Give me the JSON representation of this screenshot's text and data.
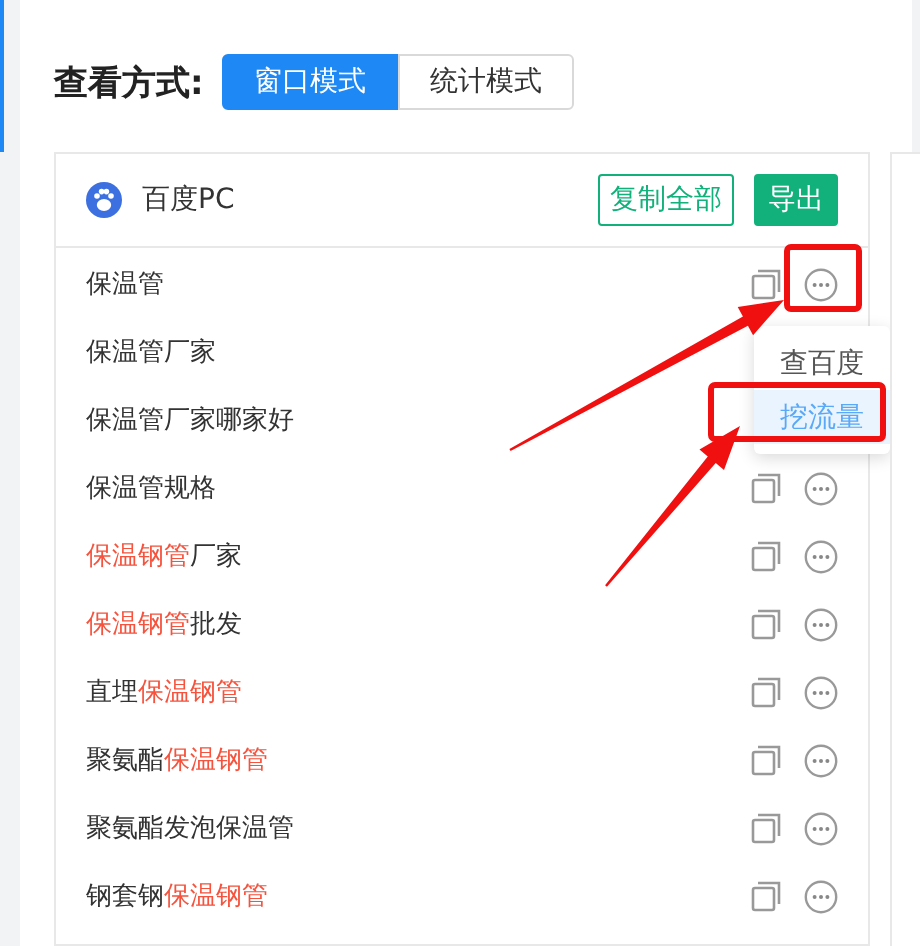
{
  "view_label": "查看方式:",
  "view_modes": [
    {
      "label": "窗口模式",
      "selected": true
    },
    {
      "label": "统计模式",
      "selected": false
    }
  ],
  "card": {
    "source": "百度PC",
    "copy_all": "复制全部",
    "export": "导出",
    "rows": [
      {
        "segments": [
          {
            "text": "保温管",
            "highlight": false
          }
        ],
        "show_actions": true
      },
      {
        "segments": [
          {
            "text": "保温管厂家",
            "highlight": false
          }
        ],
        "show_actions": false
      },
      {
        "segments": [
          {
            "text": "保温管厂家哪家好",
            "highlight": false
          }
        ],
        "show_actions": false
      },
      {
        "segments": [
          {
            "text": "保温管规格",
            "highlight": false
          }
        ],
        "show_actions": true
      },
      {
        "segments": [
          {
            "text": "保温钢管",
            "highlight": true
          },
          {
            "text": "厂家",
            "highlight": false
          }
        ],
        "show_actions": true
      },
      {
        "segments": [
          {
            "text": "保温钢管",
            "highlight": true
          },
          {
            "text": "批发",
            "highlight": false
          }
        ],
        "show_actions": true
      },
      {
        "segments": [
          {
            "text": "直埋",
            "highlight": false
          },
          {
            "text": "保温钢管",
            "highlight": true
          }
        ],
        "show_actions": true
      },
      {
        "segments": [
          {
            "text": "聚氨酯",
            "highlight": false
          },
          {
            "text": "保温钢管",
            "highlight": true
          }
        ],
        "show_actions": true
      },
      {
        "segments": [
          {
            "text": "聚氨酯发泡保温管",
            "highlight": false
          }
        ],
        "show_actions": true
      },
      {
        "segments": [
          {
            "text": "钢套钢",
            "highlight": false
          },
          {
            "text": "保温钢管",
            "highlight": true
          }
        ],
        "show_actions": true
      }
    ],
    "menu": [
      {
        "label": "查百度",
        "selected": false
      },
      {
        "label": "挖流量",
        "selected": true
      }
    ]
  }
}
